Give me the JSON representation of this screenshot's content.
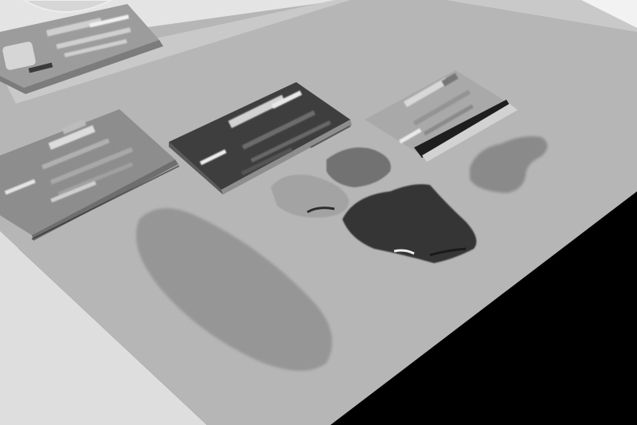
{
  "image": {
    "kind": "photograph",
    "style": "grayscale posterized",
    "colors": {
      "background_floor": "#000000",
      "table": "#b4b4b4",
      "table_edge_light": "#d8d8d8",
      "left_wall": "#e6e6e6",
      "card_light": "#9a9a9a",
      "card_dark": "#3c3c3c",
      "pouch_dark": "#353535",
      "object_mid": "#8a8a8a",
      "object_pale": "#a6a6a6",
      "blur_text": "#d0d0d0"
    }
  }
}
